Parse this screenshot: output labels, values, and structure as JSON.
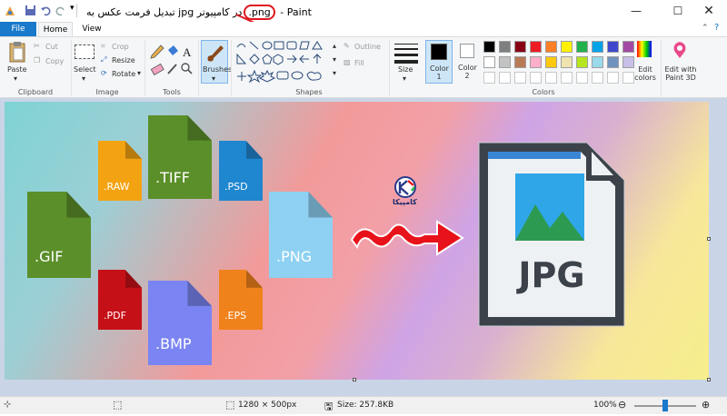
{
  "window": {
    "title": "تبدیل فرمت عکس به jpg در کامپیوتر .png - Paint",
    "title_main": "تبدیل فرمت عکس به jpg در کامپیوتر",
    "title_ext": ".png",
    "title_app": " - Paint"
  },
  "tabs": {
    "file": "File",
    "home": "Home",
    "view": "View"
  },
  "clipboard": {
    "paste": "Paste",
    "cut": "Cut",
    "copy": "Copy",
    "group": "Clipboard"
  },
  "image": {
    "select": "Select",
    "crop": "Crop",
    "resize": "Resize",
    "rotate": "Rotate",
    "group": "Image"
  },
  "tools": {
    "group": "Tools"
  },
  "brushes": {
    "label": "Brushes"
  },
  "shapes": {
    "outline": "Outline",
    "fill": "Fill",
    "group": "Shapes"
  },
  "size": {
    "label": "Size"
  },
  "colors": {
    "color1": "Color 1",
    "color2": "Color 2",
    "edit": "Edit colors",
    "paint3d": "Edit with Paint 3D",
    "group": "Colors",
    "palette": [
      "#000000",
      "#7f7f7f",
      "#880015",
      "#ed1c24",
      "#ff7f27",
      "#fff200",
      "#22b14c",
      "#00a2e8",
      "#3f48cc",
      "#a349a4",
      "#ffffff",
      "#c3c3c3",
      "#b97a57",
      "#ffaec9",
      "#ffc90e",
      "#efe4b0",
      "#b5e61d",
      "#99d9ea",
      "#7092be",
      "#c8bfe7"
    ]
  },
  "canvas": {
    "files": [
      ".TIFF",
      ".RAW",
      ".PSD",
      ".GIF",
      ".PNG",
      ".PDF",
      ".EPS",
      ".BMP"
    ],
    "target": "JPG",
    "logo_text": "کامپیکا"
  },
  "status": {
    "dimensions": "1280 × 500px",
    "size": "Size: 257.8KB",
    "zoom": "100%"
  }
}
